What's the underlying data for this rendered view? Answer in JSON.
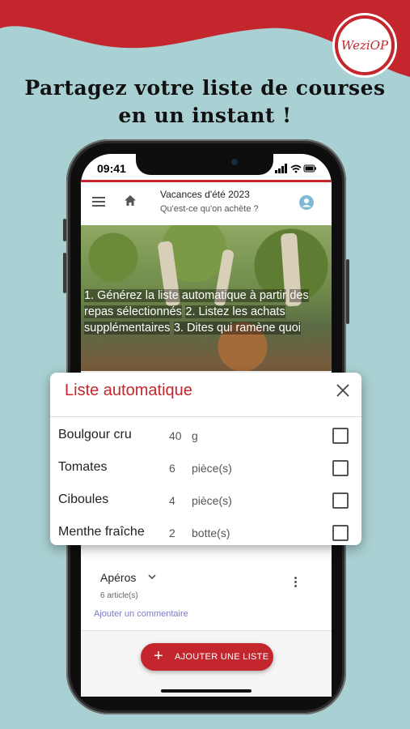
{
  "promo": {
    "headline_line1": "Partagez votre liste de courses",
    "headline_line2": "en un instant !",
    "logo_text": "WeziOP"
  },
  "status_bar": {
    "time": "09:41",
    "icons": "▂▄▆ ≋ ▭"
  },
  "header": {
    "title": "Vacances d'été 2023",
    "subtitle": "Qu'est-ce qu'on achète ?"
  },
  "banner": {
    "lines": [
      "1. Générez la liste automatique à partir",
      "des repas sélectionnés",
      "2. Listez les achats supplémentaires",
      "3. Dites qui ramène quoi"
    ]
  },
  "dialog": {
    "title": "Liste automatique",
    "items": [
      {
        "name": "Boulgour cru",
        "qty": "40",
        "unit": "g"
      },
      {
        "name": "Tomates",
        "qty": "6",
        "unit": "pièce(s)"
      },
      {
        "name": "Ciboules",
        "qty": "4",
        "unit": "pièce(s)"
      },
      {
        "name": "Menthe fraîche",
        "qty": "2",
        "unit": "botte(s)"
      }
    ]
  },
  "group": {
    "name": "Apéros",
    "count": "6 article(s)",
    "add_comment": "Ajouter un commentaire"
  },
  "fab": {
    "plus": "+",
    "label": "AJOUTER UNE LISTE"
  },
  "colors": {
    "brand_red": "#c4262d",
    "background": "#a9d0d2"
  }
}
